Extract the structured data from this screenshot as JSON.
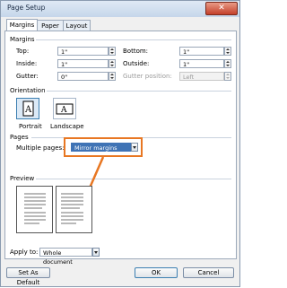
{
  "window": {
    "title": "Page Setup",
    "close_glyph": "✕"
  },
  "tabs": [
    {
      "label": "Margins"
    },
    {
      "label": "Paper"
    },
    {
      "label": "Layout"
    }
  ],
  "margins": {
    "section_label": "Margins",
    "top": {
      "label": "Top:",
      "value": "1\""
    },
    "bottom": {
      "label": "Bottom:",
      "value": "1\""
    },
    "inside": {
      "label": "Inside:",
      "value": "1\""
    },
    "outside": {
      "label": "Outside:",
      "value": "1\""
    },
    "gutter": {
      "label": "Gutter:",
      "value": "0\""
    },
    "gutter_position": {
      "label": "Gutter position:",
      "value": "Left"
    }
  },
  "orientation": {
    "section_label": "Orientation",
    "portrait": "Portrait",
    "landscape": "Landscape"
  },
  "pages": {
    "section_label": "Pages",
    "multiple_label": "Multiple pages:",
    "multiple_value": "Mirror margins"
  },
  "preview": {
    "section_label": "Preview"
  },
  "apply_to": {
    "label": "Apply to:",
    "value": "Whole document"
  },
  "buttons": {
    "set_default": "Set As Default",
    "ok": "OK",
    "cancel": "Cancel"
  },
  "colors": {
    "highlight": "#e87722"
  }
}
